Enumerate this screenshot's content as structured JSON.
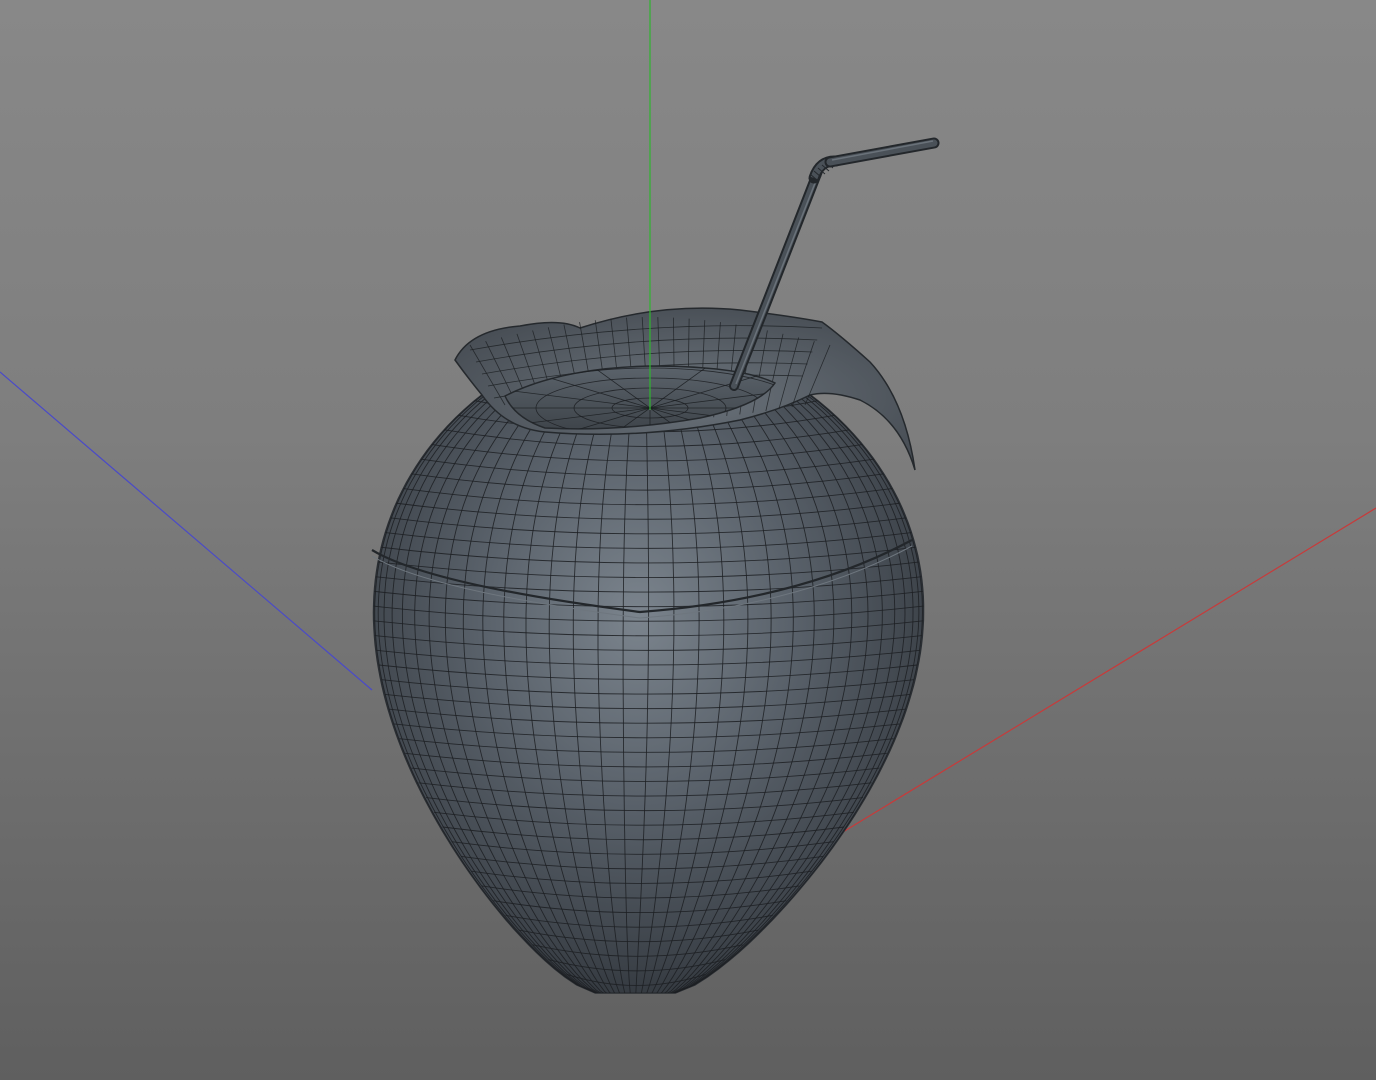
{
  "viewport": {
    "background_top": "#888888",
    "background_bottom": "#5f5f5f",
    "axes": {
      "x_color": "#c83a3a",
      "y_color": "#2fb52f",
      "z_color": "#4a4ac8"
    },
    "model": {
      "object": "coconut-with-straw",
      "display_mode": "shaded-wireframe",
      "shell_color": "#4f565e",
      "wire_color": "#1c1f22"
    }
  }
}
